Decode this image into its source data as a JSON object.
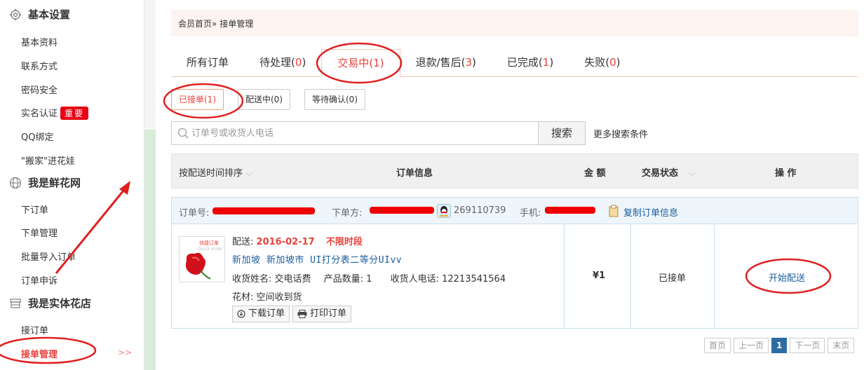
{
  "sidebar": {
    "sections": [
      {
        "title": "基本设置",
        "icon": "gear-icon",
        "items": [
          "基本资料",
          "联系方式",
          "密码安全",
          "实名认证",
          "QQ绑定",
          "\"搬家\"进花娃"
        ]
      },
      {
        "title": "我是鲜花网",
        "icon": "globe-icon",
        "items": [
          "下订单",
          "下单管理",
          "批量导入订单",
          "订单申诉"
        ]
      },
      {
        "title": "我是实体花店",
        "icon": "store-icon",
        "items": [
          "接订单",
          "接单管理"
        ]
      }
    ],
    "badge": "重要",
    "more": ">>"
  },
  "breadcrumb": {
    "home": "会员首页»",
    "current": "接单管理"
  },
  "tabs": [
    {
      "label": "所有订单",
      "count": ""
    },
    {
      "label": "待处理",
      "count": "0"
    },
    {
      "label": "交易中",
      "count": "1"
    },
    {
      "label": "退款/售后",
      "count": "3"
    },
    {
      "label": "已完成",
      "count": "1"
    },
    {
      "label": "失败",
      "count": "0"
    }
  ],
  "subtabs": [
    "已接单(1)",
    "配送中(0)",
    "等待确认(0)"
  ],
  "search": {
    "placeholder": "订单号或收货人电话",
    "button": "搜索",
    "more": "更多搜索条件"
  },
  "table_headers": {
    "sort": "按配送时间排序",
    "info": "订单信息",
    "amount": "金 额",
    "status": "交易状态",
    "action": "操 作"
  },
  "order": {
    "order_no_label": "订单号:",
    "buyer_label": "下单方:",
    "qq": "269110739",
    "phone_label": "手机:",
    "copy": "复制订单信息",
    "delivery_label": "配送:",
    "delivery_date": "2016-02-17",
    "delivery_time": "不限时段",
    "address": "新加坡 新加坡市 UI打分表二等分UIvv",
    "recipient": "收货姓名: 交电话费",
    "qty": "产品数量: 1",
    "recipient_phone": "收货人电话: 12213541564",
    "flower": "花材: 空间收到货",
    "download": "下载订单",
    "print": "打印订单",
    "amount": "¥1",
    "status": "已接单",
    "action": "开始配送",
    "thumb_text": "快捷订单",
    "thumb_sub": "Quick order"
  },
  "pager": [
    "首页",
    "上一页",
    "1",
    "下一页",
    "末页"
  ],
  "colors": {
    "accent": "#e8413b",
    "link": "#1a5e9e",
    "annotation": "#e02020"
  }
}
